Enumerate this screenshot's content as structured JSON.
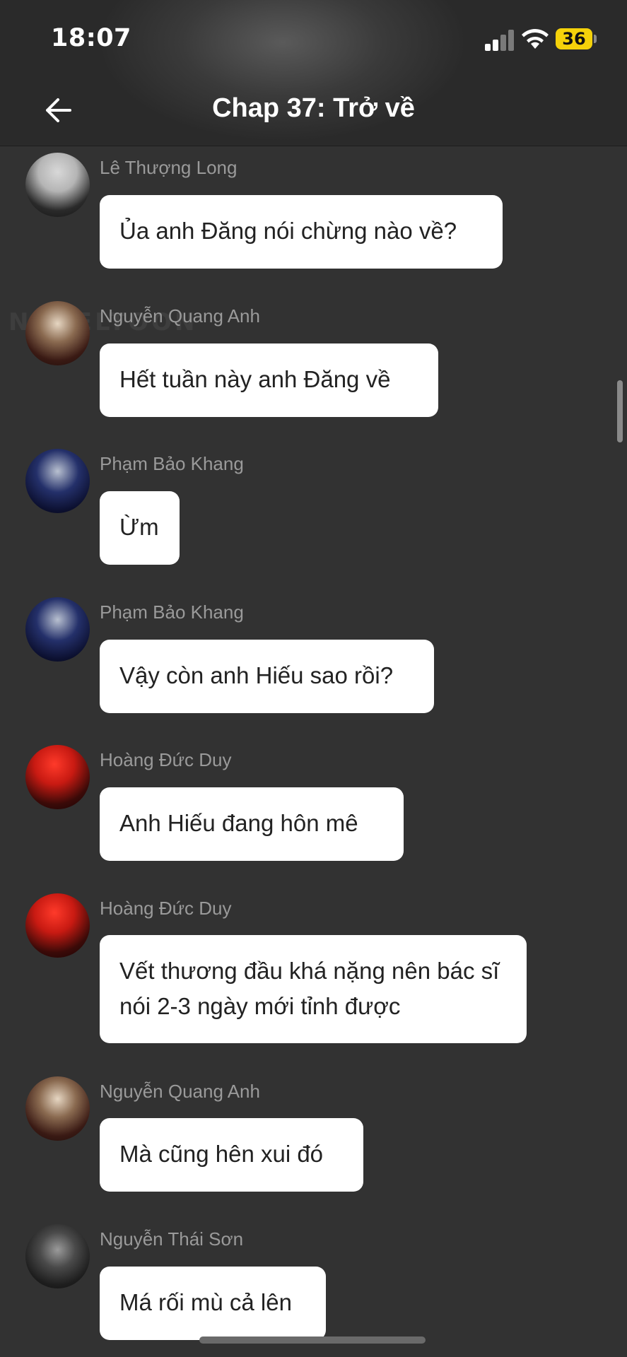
{
  "status_bar": {
    "time": "18:07",
    "battery": "36"
  },
  "header": {
    "title": "Chap 37: Trở về"
  },
  "watermark": "NOVELTOON",
  "messages": [
    {
      "sender": "Lê Thượng Long",
      "text": "Ủa anh Đăng nói chừng nào về?"
    },
    {
      "sender": "Nguyễn Quang Anh",
      "text": "Hết tuần này anh Đăng về"
    },
    {
      "sender": "Phạm Bảo Khang",
      "text": "Ừm"
    },
    {
      "sender": "Phạm Bảo Khang",
      "text": "Vậy còn anh Hiếu sao rồi?"
    },
    {
      "sender": "Hoàng Đức Duy",
      "text": "Anh Hiếu đang hôn mê"
    },
    {
      "sender": "Hoàng Đức Duy",
      "text": "Vết thương đầu khá nặng nên bác sĩ nói 2-3 ngày mới tỉnh được"
    },
    {
      "sender": "Nguyễn Quang Anh",
      "text": "Mà cũng hên xui đó"
    },
    {
      "sender": "Nguyễn Thái Sơn",
      "text": "Má rối mù cả lên"
    }
  ],
  "colors": {
    "background": "#323232",
    "bubble": "#ffffff",
    "sender_name": "#9a9a9a",
    "battery": "#f5d20a"
  }
}
